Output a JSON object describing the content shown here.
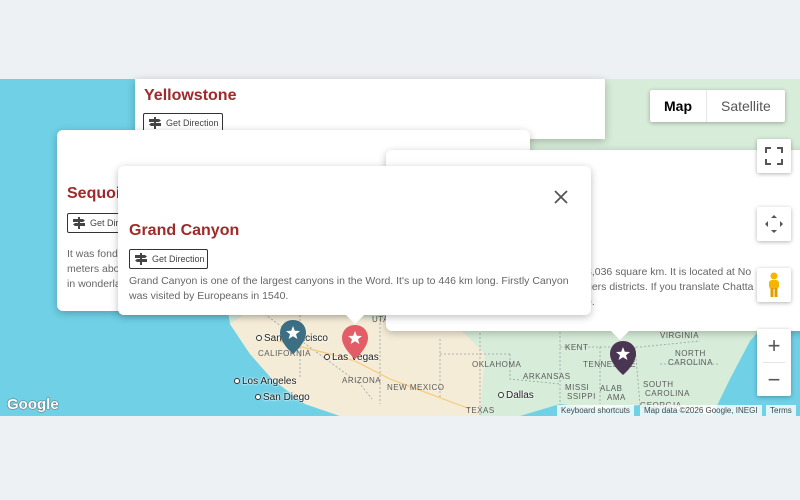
{
  "colors": {
    "title_red": "#a02a2a",
    "water": "#6fd0e6",
    "land": "#d7ecd9",
    "desert": "#f4ecd6",
    "pin_teal": "#3c6f84",
    "pin_red": "#e35d66",
    "pin_purple": "#4a3553"
  },
  "map": {
    "state_labels": [
      "UTAH",
      "CALIFORNIA",
      "ARIZONA",
      "NEW MEXICO",
      "OKLAHOMA",
      "ARKANSAS",
      "TEXAS",
      "TENNESSEE",
      "VIRGINIA",
      "NORTH CAROLINA",
      "SOUTH CAROLINA",
      "MISSISSIPPI",
      "ALABAMA",
      "GEORGIA",
      "KENT"
    ],
    "state_label_parts": {
      "north_carolina": [
        "NORTH",
        "CAROLINA"
      ],
      "south_carolina": [
        "SOUTH",
        "CAROLINA"
      ],
      "missi": "MISSI",
      "sippi": "SSIPPI",
      "alabama_a": "ALAB",
      "alabama_b": "AMA",
      "georgia_a": "GEORG",
      "georgia_b": "IA"
    },
    "city_labels": [
      "San Francisco",
      "Las Vegas",
      "Los Angeles",
      "San Diego",
      "Dallas"
    ],
    "city_partial": {
      "sf": "San Francisco",
      "sco": "sco"
    },
    "pins": [
      {
        "icon": "star-icon",
        "color": "teal"
      },
      {
        "icon": "star-icon",
        "color": "red"
      },
      {
        "icon": "star-icon",
        "color": "purple"
      }
    ]
  },
  "cards": {
    "yellowstone": {
      "title": "Yellowstone",
      "direction_label": "Get Direction"
    },
    "sequoia": {
      "title": "Sequoia",
      "direction_label": "Get Direction",
      "desc_lines": [
        "It was fond",
        "meters abo",
        "in wonderla"
      ]
    },
    "third": {
      "desc_lines": [
        "3,036 square km. It is located at No",
        "gers districts. If you translate Chatta",
        "e."
      ]
    },
    "grand_canyon": {
      "title": "Grand Canyon",
      "direction_label": "Get Direction",
      "description": "Grand Canyon is one of the largest canyons in the Word. It's up to 446 km long. Firstly Canyon was visited by Europeans in 1540.",
      "close_icon": "close-icon"
    }
  },
  "controls": {
    "map_label": "Map",
    "satellite_label": "Satellite",
    "fullscreen_icon": "fullscreen-icon",
    "camera_icon": "camera-control-icon",
    "pegman_icon": "pegman-icon",
    "zoom_in_label": "+",
    "zoom_out_label": "−"
  },
  "footer": {
    "logo": "Google",
    "keyboard_shortcuts": "Keyboard shortcuts",
    "map_data": "Map data ©2026 Google, INEGI",
    "terms": "Terms"
  }
}
